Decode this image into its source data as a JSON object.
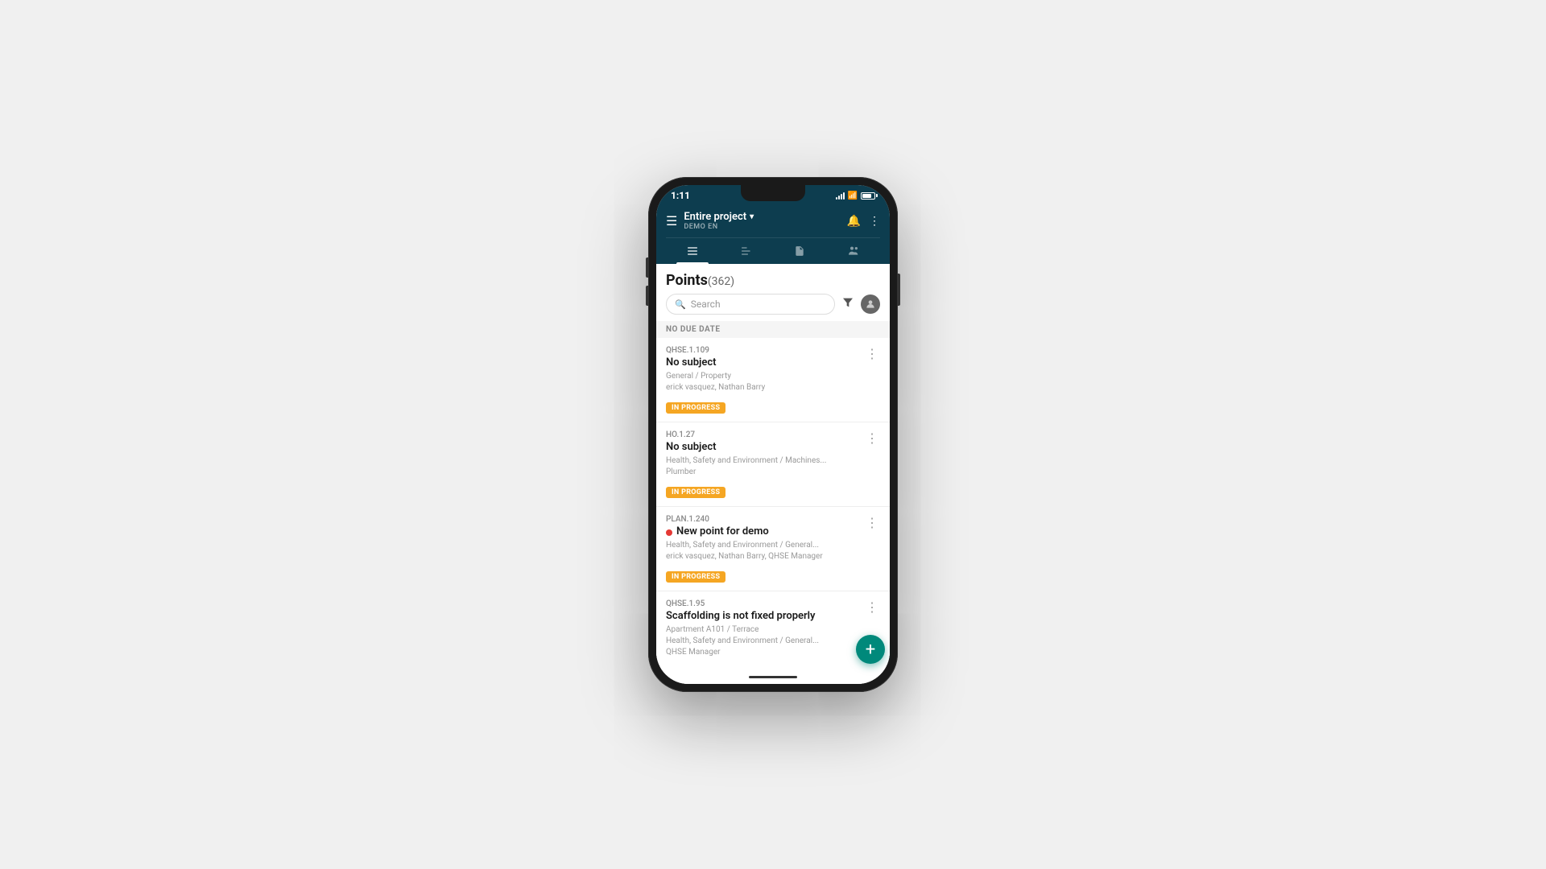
{
  "phone": {
    "time": "1:11",
    "status_icons": {
      "signal": "signal",
      "wifi": "wifi",
      "battery": "battery"
    }
  },
  "header": {
    "hamburger_label": "☰",
    "project_name": "Entire project",
    "dropdown_arrow": "▾",
    "subtitle": "DEMO EN",
    "notification_icon": "🔔",
    "more_icon": "⋮"
  },
  "tabs": [
    {
      "id": "list",
      "icon": "≡",
      "active": true
    },
    {
      "id": "gantt",
      "icon": "⋮≡",
      "active": false
    },
    {
      "id": "document",
      "icon": "📄",
      "active": false
    },
    {
      "id": "people",
      "icon": "👥",
      "active": false
    }
  ],
  "points": {
    "title": "Points",
    "count": "(362)",
    "search_placeholder": "Search",
    "section_label": "NO DUE DATE",
    "items": [
      {
        "id": "QHSE.1.109",
        "title": "No subject",
        "meta_line1": "General / Property",
        "meta_line2": "erick vasquez, Nathan Barry",
        "status": "IN PROGRESS",
        "has_red_dot": false
      },
      {
        "id": "HO.1.27",
        "title": "No subject",
        "meta_line1": "Health, Safety and Environment / Machines...",
        "meta_line2": "Plumber",
        "status": "IN PROGRESS",
        "has_red_dot": false
      },
      {
        "id": "PLAN.1.240",
        "title": "New point for demo",
        "meta_line1": "Health, Safety and Environment / General...",
        "meta_line2": "erick vasquez, Nathan Barry, QHSE Manager",
        "status": "IN PROGRESS",
        "has_red_dot": true
      },
      {
        "id": "QHSE.1.95",
        "title": "Scaffolding is not fixed properly",
        "meta_line1": "Apartment A101 / Terrace",
        "meta_line2": "Health, Safety and Environment / General...",
        "meta_line3": "QHSE Manager",
        "status": "",
        "has_red_dot": false
      }
    ]
  },
  "fab": {
    "icon": "+",
    "label": "Add point"
  },
  "colors": {
    "header_bg": "#0d3d4f",
    "in_progress_bg": "#f5a623",
    "fab_bg": "#00897b",
    "red_dot": "#e53935"
  }
}
